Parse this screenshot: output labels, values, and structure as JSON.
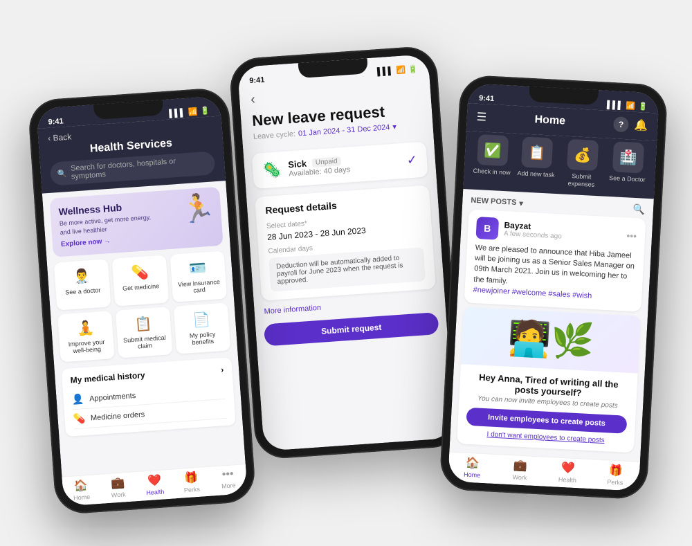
{
  "background": "#f0f0f0",
  "phones": {
    "leave": {
      "status_time": "9:41",
      "title": "New leave request",
      "back_label": "‹",
      "cycle_label": "Leave cycle:",
      "cycle_value": "01 Jan 2024 - 31 Dec 2024",
      "cycle_icon": "▾",
      "card": {
        "icon": "🦠",
        "title": "Sick",
        "badge": "Unpaid",
        "sub": "Available: 40 days",
        "check": "✓"
      },
      "section_title": "Request details",
      "field_dates_label": "Select dates*",
      "field_dates_value": "28 Jun 2023 - 28 Jun 2023",
      "field_days_label": "Calendar days",
      "info_text": "Deduction will be automatically added to payroll for June 2023 when the request is approved.",
      "more_info": "More information"
    },
    "health": {
      "status_time": "9:41",
      "header_title": "Health Services",
      "back_label": "‹ Back",
      "search_placeholder": "Search for doctors, hospitals or symptoms",
      "wellness": {
        "title": "Wellness Hub",
        "sub": "Be more active, get more energy, and live healthier",
        "link": "Explore now →"
      },
      "grid_items": [
        {
          "icon": "👨‍⚕️",
          "label": "See a doctor"
        },
        {
          "icon": "💊",
          "label": "Get medicine"
        },
        {
          "icon": "🪪",
          "label": "View insurance card"
        },
        {
          "icon": "🧘",
          "label": "Improve your well-being"
        },
        {
          "icon": "📋",
          "label": "Submit medical claim"
        },
        {
          "icon": "📄",
          "label": "My policy benefits"
        }
      ],
      "history_title": "My medical history",
      "history_arrow": "›",
      "history_items": [
        {
          "icon": "👤",
          "label": "Appointments"
        },
        {
          "icon": "💊",
          "label": "Medicine orders"
        }
      ],
      "nav": [
        {
          "icon": "🏠",
          "label": "Home",
          "active": false
        },
        {
          "icon": "💼",
          "label": "Work",
          "active": false
        },
        {
          "icon": "❤️",
          "label": "Health",
          "active": true
        },
        {
          "icon": "🎁",
          "label": "Perks",
          "active": false
        }
      ]
    },
    "home": {
      "status_time": "9:41",
      "header_title": "Home",
      "help_label": "?",
      "quick_actions": [
        {
          "icon": "✅",
          "label": "Check in now"
        },
        {
          "icon": "📋",
          "label": "Add new task"
        },
        {
          "icon": "💰",
          "label": "Submit expenses"
        },
        {
          "icon": "🏥",
          "label": "See a Doctor"
        }
      ],
      "posts_header": "NEW POSTS",
      "posts_chevron": "▾",
      "post": {
        "avatar_letter": "B",
        "author": "Bayzat",
        "time": "A few seconds ago",
        "text": "We are pleased to announce that Hiba Jameel will be joining us as a Senior Sales Manager on 09th March 2021. Join us in welcoming her to the family.",
        "tags": "#newjoiner #welcome #sales #wish"
      },
      "promo": {
        "art": "🧑‍💻",
        "title": "Hey Anna, Tired of writing all the posts yourself?",
        "sub": "You can now invite employees to create posts",
        "btn_label": "Invite employees to create posts",
        "link_label": "I don't want employees to create posts"
      },
      "nav": [
        {
          "icon": "🏠",
          "label": "Home",
          "active": true
        },
        {
          "icon": "💼",
          "label": "Work",
          "active": false
        },
        {
          "icon": "❤️",
          "label": "Health",
          "active": false
        },
        {
          "icon": "🎁",
          "label": "Perks",
          "active": false
        }
      ]
    }
  }
}
